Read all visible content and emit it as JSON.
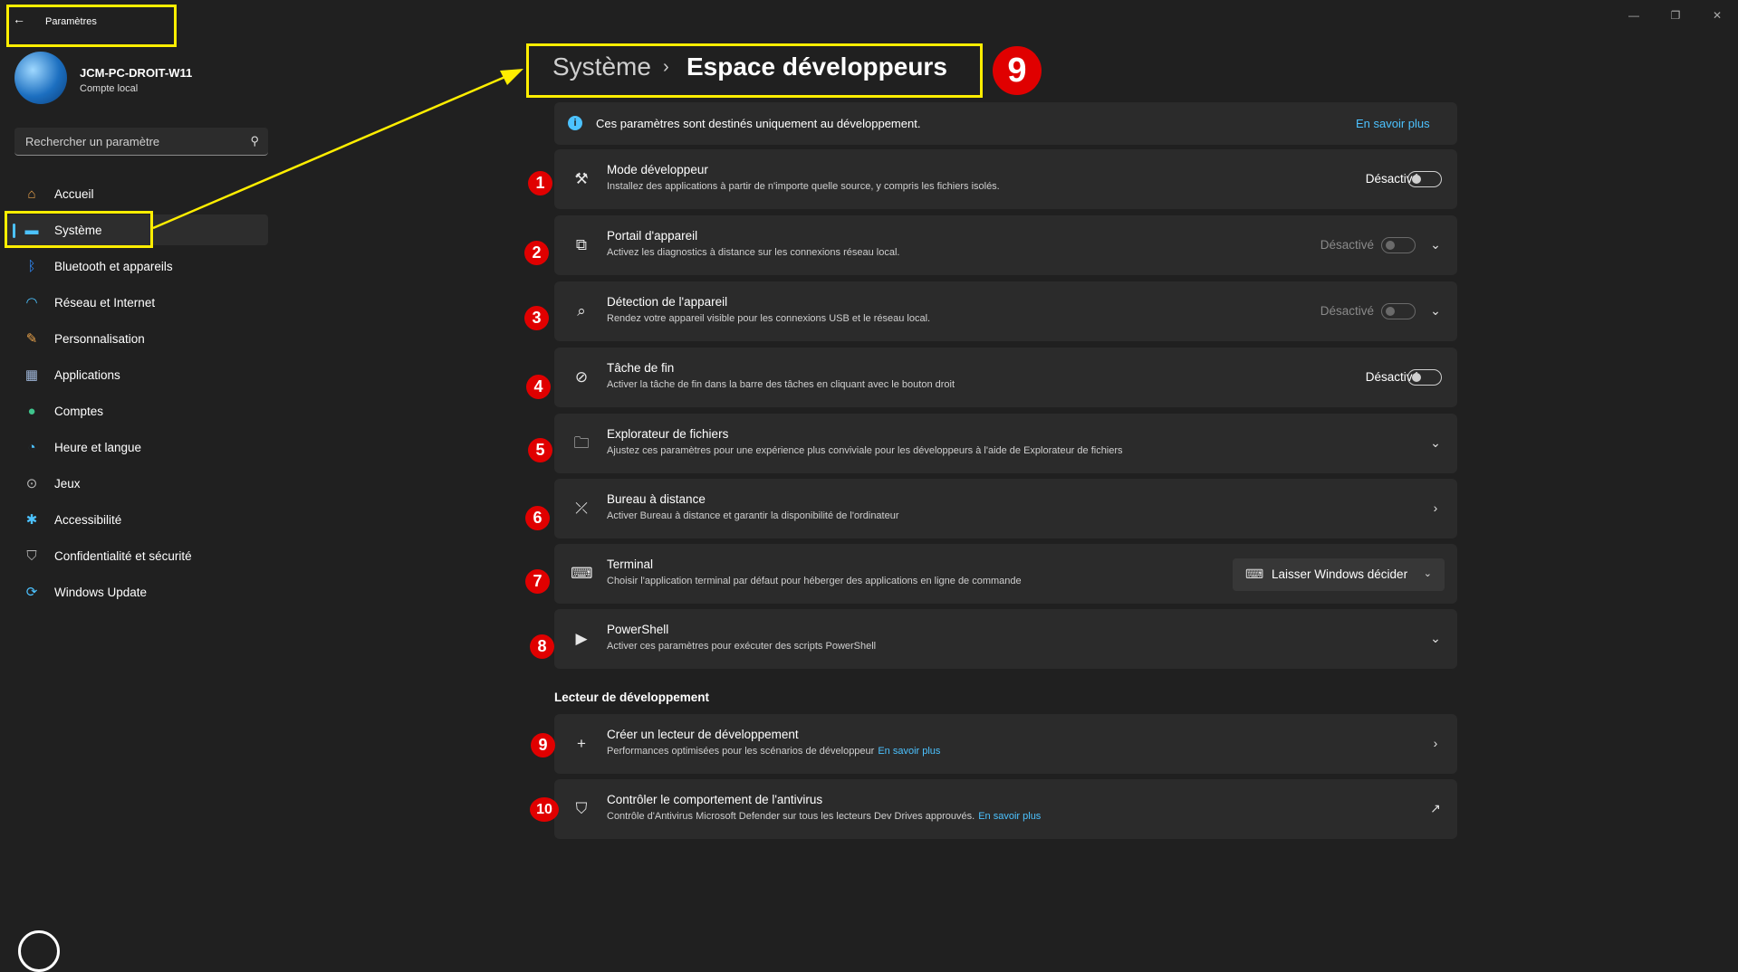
{
  "window": {
    "app_title": "Paramètres",
    "back_icon": "←",
    "minimize": "—",
    "restore": "❐",
    "close": "✕"
  },
  "user": {
    "name": "JCM-PC-DROIT-W11",
    "account_type": "Compte local"
  },
  "search": {
    "placeholder": "Rechercher un paramètre",
    "icon": "⚲"
  },
  "sidebar": {
    "items": [
      {
        "label": "Accueil",
        "icon": "home-icon",
        "glyph": "⌂",
        "color": "#e8a24a"
      },
      {
        "label": "Système",
        "icon": "monitor-icon",
        "glyph": "▬",
        "color": "#4cc2ff",
        "selected": true
      },
      {
        "label": "Bluetooth et appareils",
        "icon": "bluetooth-icon",
        "glyph": "ᛒ",
        "color": "#2f8cff"
      },
      {
        "label": "Réseau et Internet",
        "icon": "wifi-icon",
        "glyph": "◠",
        "color": "#4cc2ff"
      },
      {
        "label": "Personnalisation",
        "icon": "brush-icon",
        "glyph": "✎",
        "color": "#e8a24a"
      },
      {
        "label": "Applications",
        "icon": "apps-icon",
        "glyph": "▦",
        "color": "#9db4d6"
      },
      {
        "label": "Comptes",
        "icon": "person-icon",
        "glyph": "●",
        "color": "#3fc48c"
      },
      {
        "label": "Heure et langue",
        "icon": "globe-clock-icon",
        "glyph": "◔",
        "color": "#4cc2ff"
      },
      {
        "label": "Jeux",
        "icon": "gamepad-icon",
        "glyph": "⊙",
        "color": "#b8b8b8"
      },
      {
        "label": "Accessibilité",
        "icon": "accessibility-icon",
        "glyph": "✱",
        "color": "#4cc2ff"
      },
      {
        "label": "Confidentialité et sécurité",
        "icon": "shield-icon",
        "glyph": "⛉",
        "color": "#b8b8b8"
      },
      {
        "label": "Windows Update",
        "icon": "update-icon",
        "glyph": "⟳",
        "color": "#4cc2ff"
      }
    ]
  },
  "breadcrumb": {
    "parent": "Système",
    "separator": "›",
    "current": "Espace développeurs",
    "badge": "9"
  },
  "info": {
    "text": "Ces paramètres sont destinés uniquement au développement.",
    "link": "En savoir plus",
    "icon": "i"
  },
  "settings": [
    {
      "badge": "1",
      "icon": "dev-tools-icon",
      "glyph": "⚒",
      "title": "Mode développeur",
      "subtitle": "Installez des applications à partir de n'importe quelle source, y compris les fichiers isolés.",
      "state": "Désactivé",
      "toggle": "off",
      "enabled": true
    },
    {
      "badge": "2",
      "icon": "device-portal-icon",
      "glyph": "⧉",
      "title": "Portail d'appareil",
      "subtitle": "Activez les diagnostics à distance sur les connexions réseau local.",
      "state": "Désactivé",
      "toggle": "off",
      "enabled": false,
      "chevron": "⌄"
    },
    {
      "badge": "3",
      "icon": "device-discovery-icon",
      "glyph": "⌕",
      "title": "Détection de l'appareil",
      "subtitle": "Rendez votre appareil visible pour les connexions USB et le réseau local.",
      "state": "Désactivé",
      "toggle": "off",
      "enabled": false,
      "chevron": "⌄"
    },
    {
      "badge": "4",
      "icon": "end-task-icon",
      "glyph": "⊘",
      "title": "Tâche de fin",
      "subtitle": "Activer la tâche de fin dans la barre des tâches en cliquant avec le bouton droit",
      "state": "Désactivé",
      "toggle": "off",
      "enabled": true
    },
    {
      "badge": "5",
      "icon": "file-explorer-icon",
      "glyph": "🗀",
      "title": "Explorateur de fichiers",
      "subtitle": "Ajustez ces paramètres pour une expérience plus conviviale pour les développeurs à l'aide de Explorateur de fichiers",
      "chevron": "⌄"
    },
    {
      "badge": "6",
      "icon": "remote-desktop-icon",
      "glyph": "⤫",
      "title": "Bureau à distance",
      "subtitle": "Activer Bureau à distance et garantir la disponibilité de l'ordinateur",
      "chevron": "›"
    },
    {
      "badge": "7",
      "icon": "terminal-icon",
      "glyph": "⌨",
      "title": "Terminal",
      "subtitle": "Choisir l'application terminal par défaut pour héberger des applications en ligne de commande",
      "dropdown": "Laisser Windows décider"
    },
    {
      "badge": "8",
      "icon": "powershell-icon",
      "glyph": "▶",
      "title": "PowerShell",
      "subtitle": "Activer ces paramètres pour exécuter des scripts PowerShell",
      "chevron": "⌄"
    }
  ],
  "dev_drive": {
    "section_title": "Lecteur de développement",
    "items": [
      {
        "badge": "9",
        "icon": "plus-icon",
        "glyph": "+",
        "title": "Créer un lecteur de développement",
        "subtitle": "Performances optimisées pour les scénarios de développeur",
        "link": "En savoir plus",
        "chevron": "›"
      },
      {
        "badge": "10",
        "icon": "shield-outline-icon",
        "glyph": "⛉",
        "title": "Contrôler le comportement de l'antivirus",
        "subtitle": "Contrôle d'Antivirus Microsoft Defender sur tous les lecteurs Dev Drives approuvés.",
        "link": "En savoir plus",
        "chevron": "↗"
      }
    ]
  },
  "colors": {
    "background": "#202020",
    "card": "#2b2b2b",
    "accent": "#4cc2ff",
    "highlight": "#ffee00",
    "badge": "#e00000"
  }
}
